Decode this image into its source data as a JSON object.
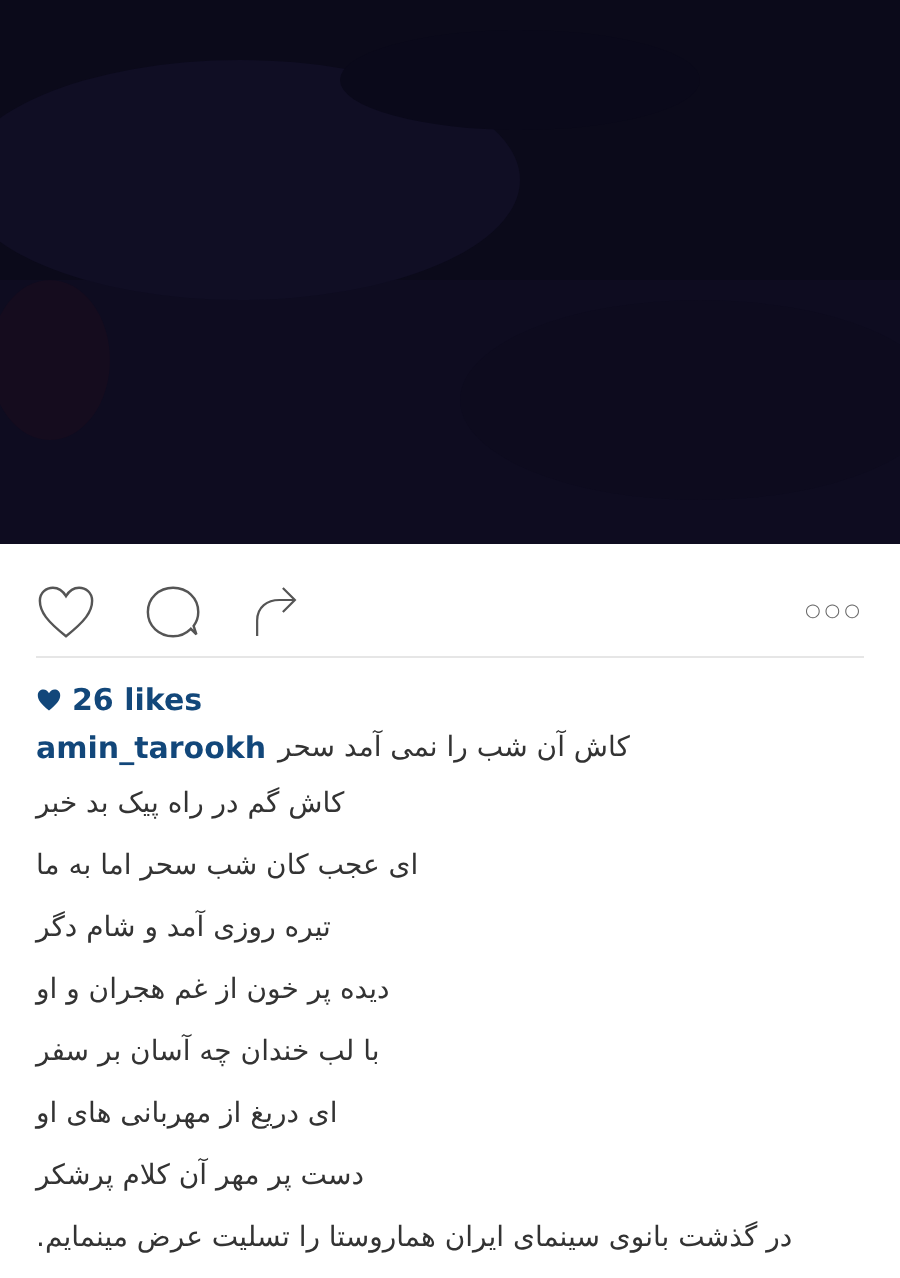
{
  "post": {
    "liked": false,
    "more_button": "○○○",
    "likes": "26 likes",
    "username": "amin_tarookh",
    "caption_lines": [
      "کاش آن شب را نمی  آمد سحر",
      "کاش گم در راه پیک بد خبر",
      "ای عجب کان شب سحر اما به  ما",
      "تیره روزی آمد و شام دگر",
      "دیده پر خون از غم هجران و او",
      "با  لب خندان چه آسان بر سفر",
      "ای دریغ از مهربانی های او",
      "دست پر مهر آن  کلام پرشکر",
      "در گذشت بانوی سینمای ایران هماروستا را تسلیت عرض مینمایم."
    ]
  }
}
